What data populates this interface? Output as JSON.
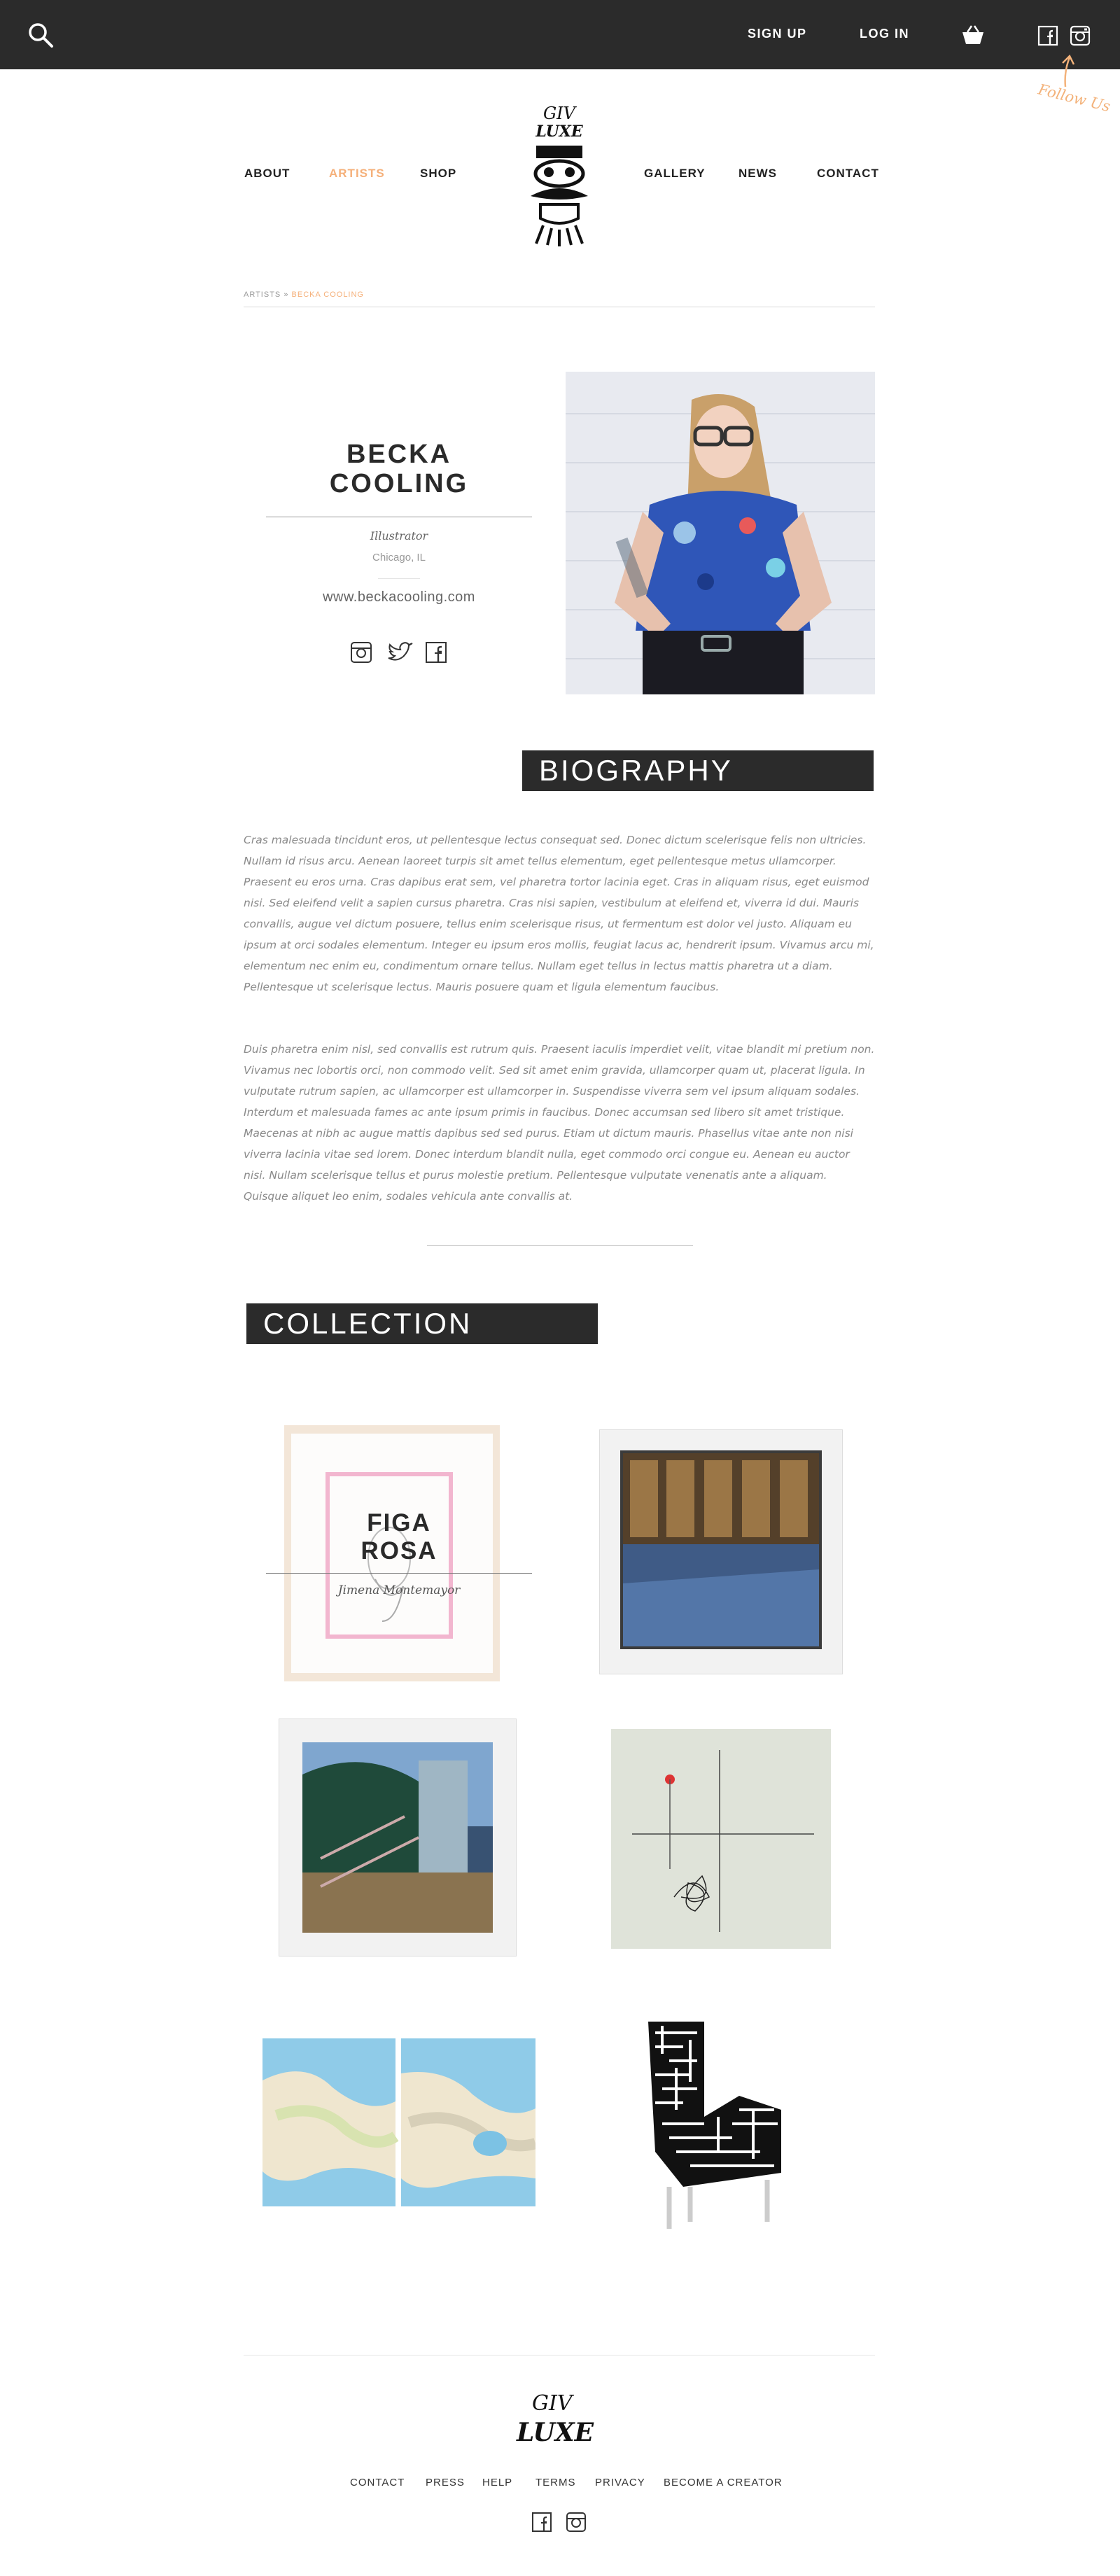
{
  "topbar": {
    "signup": "SIGN UP",
    "login": "LOG IN",
    "follow_note": "Follow Us"
  },
  "logo": {
    "text_top": "GIV",
    "text_bottom": "LUXE"
  },
  "nav": {
    "left": [
      "ABOUT",
      "ARTISTS",
      "SHOP"
    ],
    "right": [
      "GALLERY",
      "NEWS",
      "CONTACT"
    ],
    "active": "ARTISTS"
  },
  "breadcrumb": {
    "parent": "ARTISTS",
    "separator": "»",
    "current": "BECKA COOLING"
  },
  "artist": {
    "name_line1": "BECKA",
    "name_line2": "COOLING",
    "role": "Illustrator",
    "location": "Chicago, IL",
    "website": "www.beckacooling.com",
    "social_icons": [
      "instagram-icon",
      "twitter-icon",
      "facebook-icon"
    ]
  },
  "biography": {
    "title": "BIOGRAPHY",
    "paragraphs": [
      "Cras malesuada tincidunt eros, ut pellentesque lectus consequat sed. Donec dictum scelerisque felis non ultricies. Nullam id risus arcu. Aenean laoreet turpis sit amet tellus elementum, eget pellentesque metus ullamcorper. Praesent eu eros urna. Cras dapibus erat sem, vel pharetra tortor lacinia eget. Cras in aliquam risus, eget euismod nisi. Sed eleifend velit a sapien cursus pharetra. Cras nisi sapien, vestibulum at eleifend et, viverra id dui. Mauris convallis, augue vel dictum posuere, tellus enim scelerisque risus, ut fermentum est dolor vel justo. Aliquam eu ipsum at orci sodales elementum. Integer eu ipsum eros mollis, feugiat lacus ac, hendrerit ipsum. Vivamus arcu mi, elementum nec enim eu, condimentum ornare tellus. Nullam eget tellus in lectus mattis pharetra ut a diam. Pellentesque ut scelerisque lectus. Mauris posuere quam et ligula elementum faucibus.",
      "Duis pharetra enim nisl, sed convallis est rutrum quis. Praesent iaculis imperdiet velit, vitae blandit mi pretium non. Vivamus nec lobortis orci, non commodo velit. Sed sit amet enim gravida, ullamcorper quam ut, placerat ligula. In vulputate rutrum sapien, ac ullamcorper est ullamcorper in. Suspendisse viverra sem vel ipsum aliquam sodales. Interdum et malesuada fames ac ante ipsum primis in faucibus. Donec accumsan sed libero sit amet tristique. Maecenas at nibh ac augue mattis dapibus sed sed purus. Etiam ut dictum mauris. Phasellus vitae ante non nisi viverra lacinia vitae sed lorem. Donec interdum blandit nulla, eget commodo orci congue eu. Aenean eu auctor nisi. Nullam scelerisque tellus et purus molestie pretium. Pellentesque vulputate venenatis ante a aliquam. Quisque aliquet leo enim, sodales vehicula ante convallis at."
    ]
  },
  "collection": {
    "title": "COLLECTION",
    "featured": {
      "title_line1": "FIGA",
      "title_line2": "ROSA",
      "artist": "Jimena Montemayor"
    }
  },
  "footer": {
    "links": [
      "CONTACT",
      "PRESS",
      "HELP",
      "TERMS",
      "PRIVACY",
      "BECOME A CREATOR"
    ]
  },
  "colors": {
    "dark": "#2b2b2b",
    "accent": "#f5b07a",
    "text_gray": "#8a8a8a"
  }
}
